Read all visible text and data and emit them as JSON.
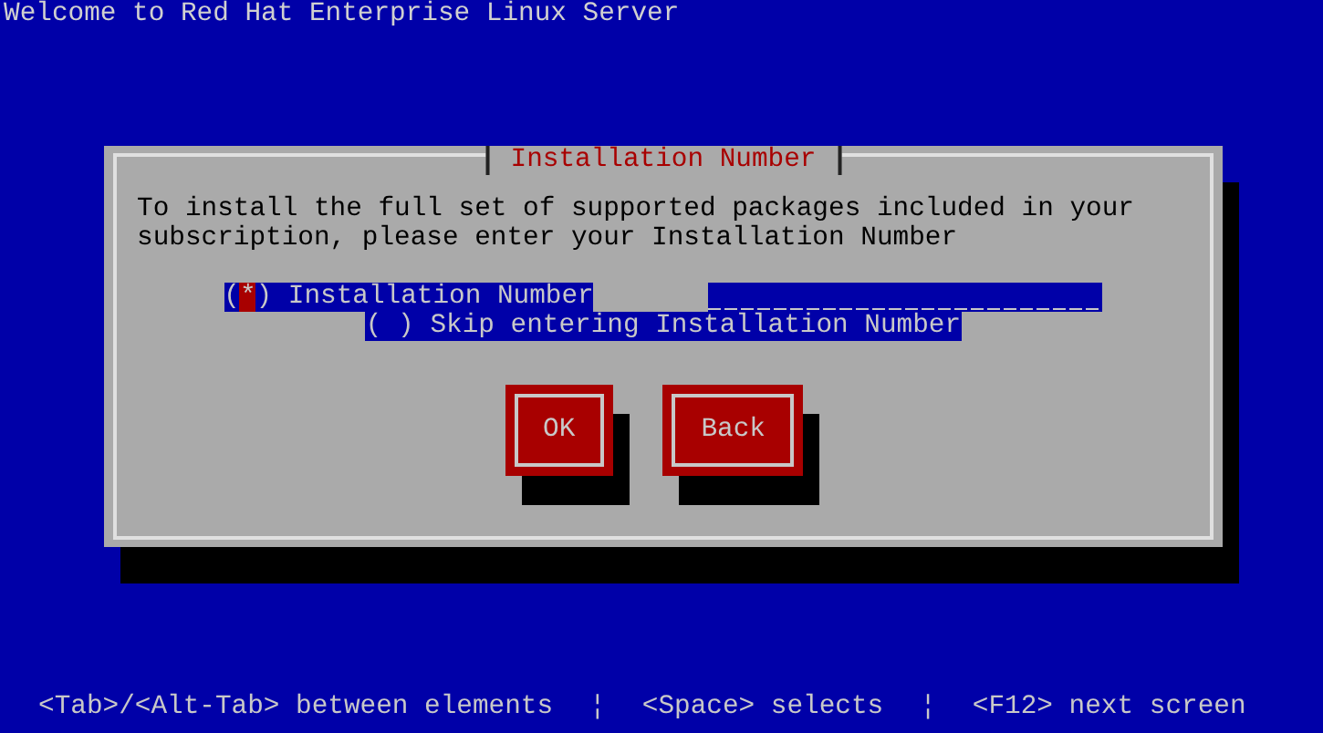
{
  "screen_title": "Welcome to Red Hat Enterprise Linux Server",
  "dialog": {
    "title": "Installation Number",
    "message": "To install the full set of supported packages included in your subscription, please enter your Installation Number",
    "radio_brackets": [
      "(",
      ")"
    ],
    "radio_mark": "*",
    "options": [
      {
        "label": "Installation Number",
        "selected": true,
        "has_field": true,
        "focused": true
      },
      {
        "label": "Skip entering Installation Number",
        "selected": false,
        "has_field": false,
        "focused": false
      }
    ],
    "buttons": [
      {
        "label": "OK"
      },
      {
        "label": "Back"
      }
    ]
  },
  "help_line": {
    "items": [
      "<Tab>/<Alt-Tab> between elements",
      "<Space> selects",
      "<F12> next screen"
    ],
    "separator": "¦"
  }
}
